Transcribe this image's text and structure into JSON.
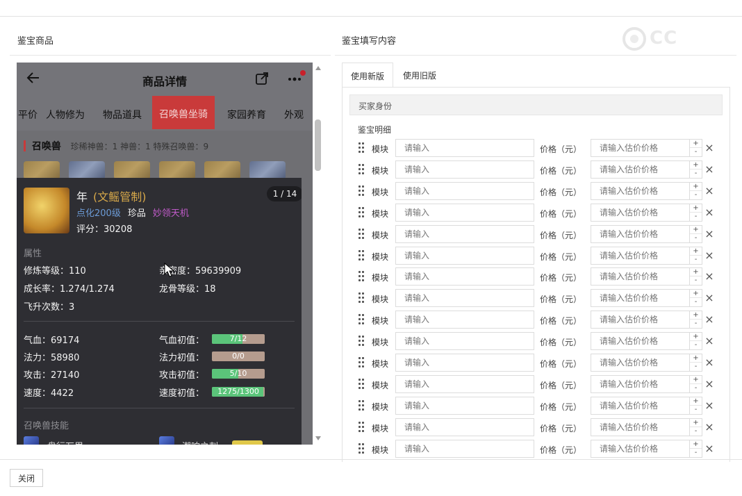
{
  "left_section_title": "鉴宝商品",
  "right_section_title": "鉴宝填写内容",
  "watermark": "CC",
  "phone": {
    "title": "商品详情",
    "tabs": [
      "平价",
      "人物修为",
      "物品道具",
      "召唤兽坐骑",
      "家园养育",
      "外观"
    ],
    "active_tab": "召唤兽坐骑",
    "summon_label": "召唤兽",
    "summon_counts": "珍稀神兽：1  神兽：1  特殊召唤兽：9",
    "accent_color": "#c93a3a"
  },
  "card": {
    "name": "年",
    "tag": "(文鳐管制)",
    "level": "点化200级",
    "rarity": "珍品",
    "skill_highlight": "妙领天机",
    "score": "评分：30208",
    "pager": "1 / 14",
    "attr_heading": "属性",
    "attrs": [
      {
        "label": "修炼等级：",
        "value": "110"
      },
      {
        "label": "亲密度：",
        "value": "59639909"
      },
      {
        "label": "成长率：",
        "value": "1.274/1.274"
      },
      {
        "label": "龙骨等级：",
        "value": "18"
      },
      {
        "label": "飞升次数：",
        "value": "3"
      }
    ],
    "stats": [
      {
        "label": "气血：",
        "value": "69174",
        "init_label": "气血初值：",
        "init": "7/12",
        "fill": 0.583
      },
      {
        "label": "法力：",
        "value": "58980",
        "init_label": "法力初值：",
        "init": "0/0",
        "fill": 0
      },
      {
        "label": "攻击：",
        "value": "27140",
        "init_label": "攻击初值：",
        "init": "5/10",
        "fill": 0.5
      },
      {
        "label": "速度：",
        "value": "4422",
        "init_label": "速度初值：",
        "init": "1275/1300",
        "fill": 0.98
      }
    ],
    "skills_heading": "召唤兽技能",
    "skill_1": "盘行万里",
    "skill_2": "潮响之刺"
  },
  "form": {
    "tabs": [
      "使用新版",
      "使用旧版"
    ],
    "active_tab": "使用新版",
    "buyer_label": "买家身份",
    "detail_label": "鉴宝明细",
    "module_label": "模块",
    "name_placeholder": "请输入",
    "price_label": "价格（元）",
    "price_placeholder": "请输入估价价格",
    "row_count": 15
  },
  "close_button": "关闭"
}
